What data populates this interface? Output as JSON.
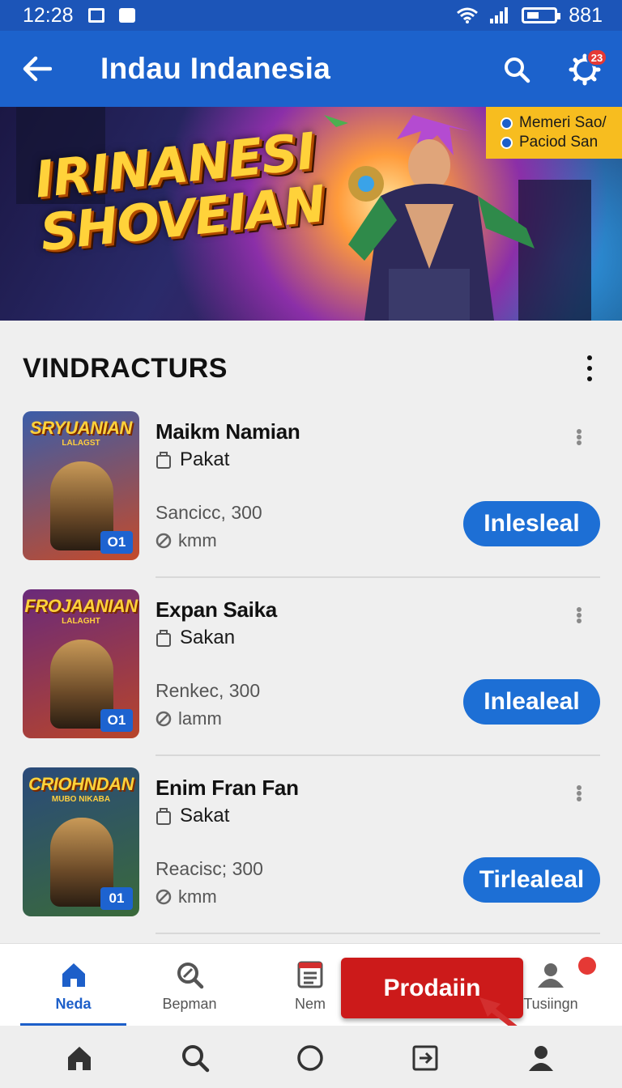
{
  "status_bar": {
    "time": "12:28",
    "battery": "881"
  },
  "app_bar": {
    "title": "Indau Indanesia",
    "notification_count": "23"
  },
  "banner": {
    "title_line1": "IRINANESI",
    "title_line2": "SHOVEIAN",
    "tag_line1": "Memeri Sao/",
    "tag_line2": "Paciod San"
  },
  "section": {
    "title": "VINDRACTURS"
  },
  "items": [
    {
      "thumb_title": "SRYUANIAN",
      "thumb_sub": "LALAGST",
      "badge": "O1",
      "name": "Maikm Namian",
      "category": "Pakat",
      "price": "Sancicc, 300",
      "meta": "kmm",
      "action": "Inlesleal",
      "thumb_colors": [
        "#3b5da8",
        "#c44a2a"
      ]
    },
    {
      "thumb_title": "FROJAANIAN",
      "thumb_sub": "LALAGHT",
      "badge": "O1",
      "name": "Expan Saika",
      "category": "Sakan",
      "price": "Renkec, 300",
      "meta": "lamm",
      "action": "Inlealeal",
      "thumb_colors": [
        "#6a2a7a",
        "#b8452a"
      ]
    },
    {
      "thumb_title": "CRIOHNDAN",
      "thumb_sub": "MUBO NIKABA",
      "badge": "01",
      "name": "Enim Fran Fan",
      "category": "Sakat",
      "price": "Reacisc; 300",
      "meta": "kmm",
      "action": "Tirlealeal",
      "thumb_colors": [
        "#2a4a7a",
        "#3a6a3a"
      ]
    }
  ],
  "tabs": [
    {
      "label": "Neda",
      "icon": "home-icon",
      "active": true
    },
    {
      "label": "Bepman",
      "icon": "search-magnifier-icon",
      "active": false
    },
    {
      "label": "Nem",
      "icon": "list-document-icon",
      "active": false
    },
    {
      "label": "Tusiingn",
      "icon": "profile-notify-icon",
      "active": false
    }
  ],
  "promo": {
    "label": "Prodaiin"
  },
  "colors": {
    "primary": "#1c62cc",
    "status": "#1c55b8",
    "action": "#1d6fd5",
    "promo": "#cc1a1a",
    "badge": "#e53935"
  }
}
